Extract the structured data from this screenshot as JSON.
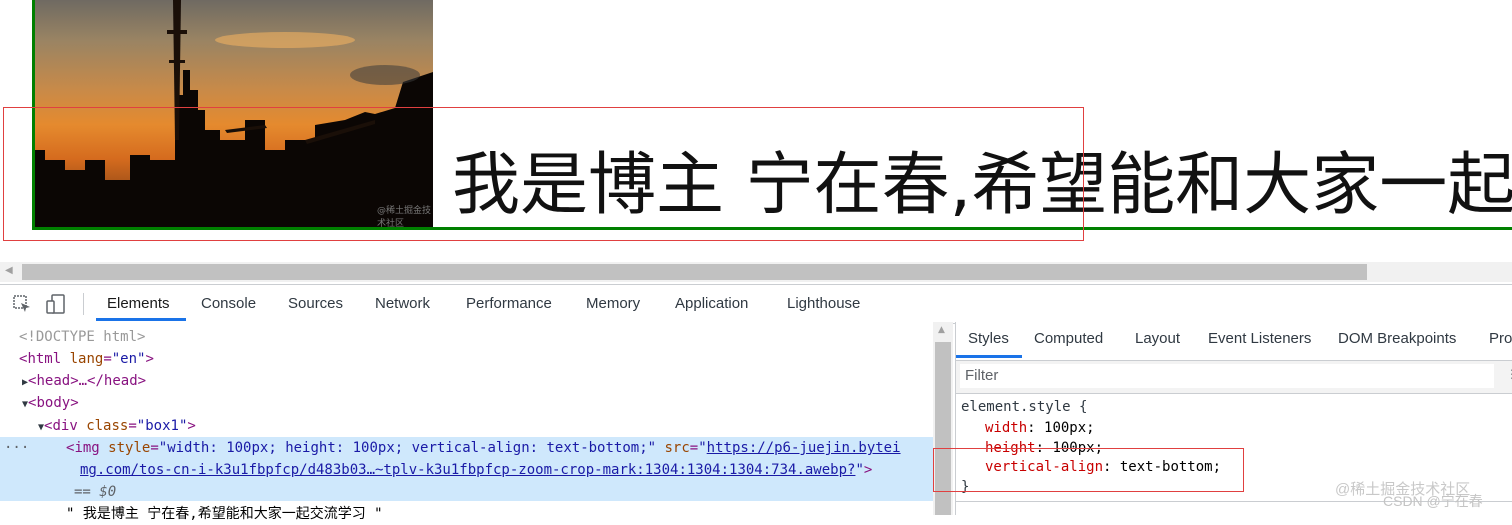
{
  "preview": {
    "paragraph_text": "我是博主 宁在春,希望能和大家一起交流学习",
    "image_watermark": "@稀土掘金技术社区"
  },
  "devtools": {
    "tabs": [
      "Elements",
      "Console",
      "Sources",
      "Network",
      "Performance",
      "Memory",
      "Application",
      "Lighthouse"
    ],
    "active_tab": "Elements",
    "dom": {
      "doctype": "<!DOCTYPE html>",
      "html_tag": "html",
      "html_lang_attr": "lang",
      "html_lang_val": "\"en\"",
      "head": "head",
      "head_close": "…</head>",
      "body": "body",
      "div_tag": "div",
      "div_class_attr": "class",
      "div_class_val": "\"box1\"",
      "img_tag": "img",
      "img_style_attr": "style",
      "img_style_val": "\"width: 100px; height: 100px; vertical-align: text-bottom;\"",
      "img_src_attr": "src",
      "img_src_part1": "https://p6-juejin.bytei",
      "img_src_part2": "mg.com/tos-cn-i-k3u1fbpfcp/d483b03…~tplv-k3u1fbpfcp-zoom-crop-mark:1304:1304:1304:734.awebp?",
      "eq_dollar": "== $0",
      "text_node": "\" 我是博主 宁在春,希望能和大家一起交流学习 \""
    },
    "styles_tabs": [
      "Styles",
      "Computed",
      "Layout",
      "Event Listeners",
      "DOM Breakpoints",
      "Pro"
    ],
    "filter_placeholder": "Filter",
    "rule": {
      "selector": "element.style {",
      "props": [
        {
          "name": "width",
          "value": "100px;"
        },
        {
          "name": "height",
          "value": "100px;"
        },
        {
          "name": "vertical-align",
          "value": "text-bottom;"
        }
      ],
      "close": "}"
    }
  },
  "watermarks": {
    "site": "@稀土掘金技术社区",
    "csdn": "CSDN @宁在春"
  },
  "colors": {
    "border_green": "#008000",
    "annotation_red": "#e04040",
    "selected_row": "#cfe8fc",
    "accent_blue": "#1a73e8"
  }
}
